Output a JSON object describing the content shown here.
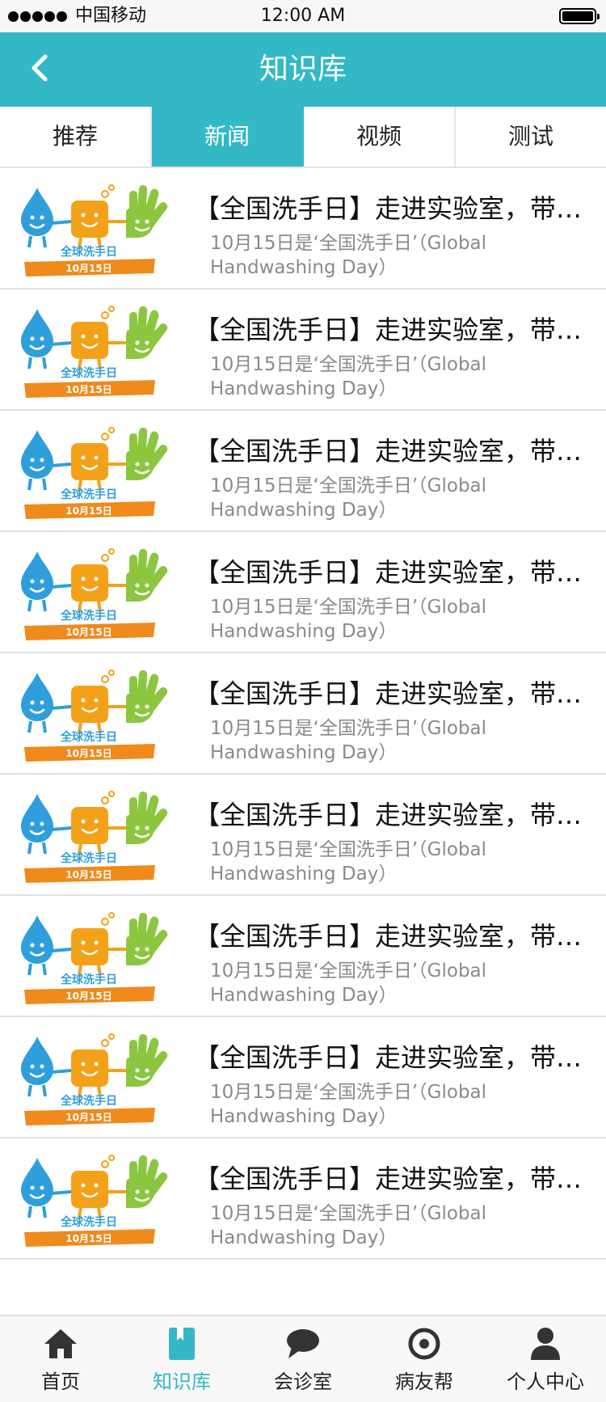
{
  "status_bar": {
    "carrier": "中国移动",
    "time": "12:00 AM"
  },
  "nav": {
    "title": "知识库"
  },
  "tabs": [
    {
      "label": "推荐",
      "active": false
    },
    {
      "label": "新闻",
      "active": true
    },
    {
      "label": "视频",
      "active": false
    },
    {
      "label": "测试",
      "active": false
    }
  ],
  "list": {
    "items": [
      {
        "title": "【全国洗手日】走进实验室，带你看手上的细菌",
        "desc": "10月15日是‘全国洗手日’（Global Handwashing Day）",
        "thumb_text": "全球洗手日",
        "thumb_date": "10月15日"
      },
      {
        "title": "【全国洗手日】走进实验室，带你看手上的细菌",
        "desc": "10月15日是‘全国洗手日’（Global Handwashing Day）",
        "thumb_text": "全球洗手日",
        "thumb_date": "10月15日"
      },
      {
        "title": "【全国洗手日】走进实验室，带你看手上的细菌",
        "desc": "10月15日是‘全国洗手日’（Global Handwashing Day）",
        "thumb_text": "全球洗手日",
        "thumb_date": "10月15日"
      },
      {
        "title": "【全国洗手日】走进实验室，带你看手上的细菌",
        "desc": "10月15日是‘全国洗手日’（Global Handwashing Day）",
        "thumb_text": "全球洗手日",
        "thumb_date": "10月15日"
      },
      {
        "title": "【全国洗手日】走进实验室，带你看手上的细菌",
        "desc": "10月15日是‘全国洗手日’（Global Handwashing Day）",
        "thumb_text": "全球洗手日",
        "thumb_date": "10月15日"
      },
      {
        "title": "【全国洗手日】走进实验室，带你看手上的细菌",
        "desc": "10月15日是‘全国洗手日’（Global Handwashing Day）",
        "thumb_text": "全球洗手日",
        "thumb_date": "10月15日"
      },
      {
        "title": "【全国洗手日】走进实验室，带你看手上的细菌",
        "desc": "10月15日是‘全国洗手日’（Global Handwashing Day）",
        "thumb_text": "全球洗手日",
        "thumb_date": "10月15日"
      },
      {
        "title": "【全国洗手日】走进实验室，带你看手上的细菌",
        "desc": "10月15日是‘全国洗手日’（Global Handwashing Day）",
        "thumb_text": "全球洗手日",
        "thumb_date": "10月15日"
      },
      {
        "title": "【全国洗手日】走进实验室，带你看手上的细菌",
        "desc": "10月15日是‘全国洗手日’（Global Handwashing Day）",
        "thumb_text": "全球洗手日",
        "thumb_date": "10月15日"
      }
    ]
  },
  "bottom_nav": [
    {
      "label": "首页",
      "icon": "home-icon",
      "active": false
    },
    {
      "label": "知识库",
      "icon": "book-icon",
      "active": true
    },
    {
      "label": "会诊室",
      "icon": "chat-bubble-icon",
      "active": false
    },
    {
      "label": "病友帮",
      "icon": "target-icon",
      "active": false
    },
    {
      "label": "个人中心",
      "icon": "user-icon",
      "active": false
    }
  ],
  "colors": {
    "accent": "#33b8c6",
    "thumb_blue": "#2f9fdc",
    "thumb_orange": "#f4a11a",
    "thumb_green": "#8cc63f",
    "thumb_banner": "#f08a1c"
  }
}
